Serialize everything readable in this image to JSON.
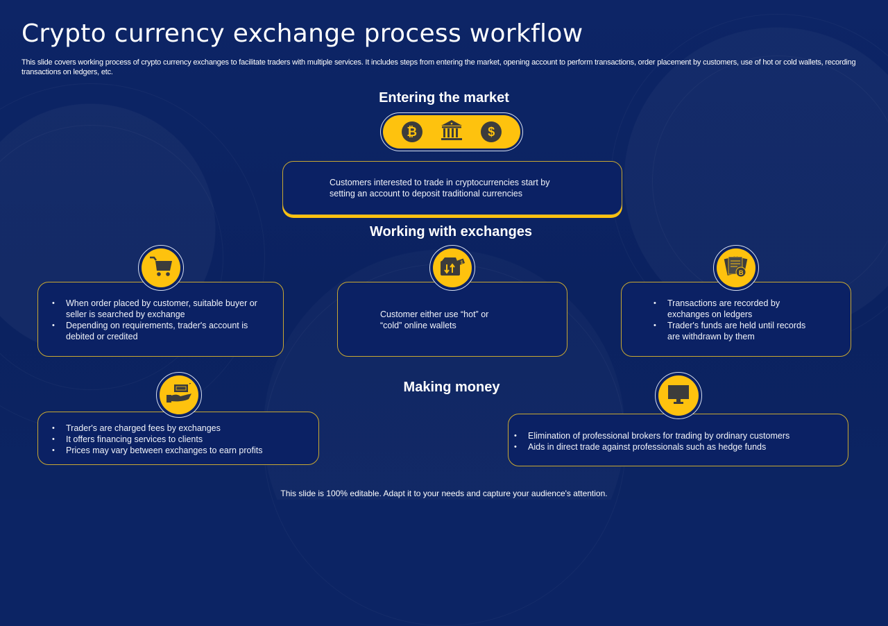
{
  "slide": {
    "title": "Crypto currency exchange process workflow",
    "subtitle": "This slide covers working process of crypto currency exchanges to facilitate traders with multiple services. It includes steps from entering the market, opening account to perform transactions, order placement by customers, use of hot or cold wallets, recording transactions on ledgers, etc.",
    "footer": "This slide is 100% editable. Adapt it to your needs and capture your audience's attention."
  },
  "colors": {
    "background": "#0c2464",
    "accent": "#fec20e",
    "box_border": "#c9a832",
    "icon_dark": "#3c3c3c"
  },
  "sections": {
    "entering": {
      "heading": "Entering the market",
      "icons": [
        "bitcoin-icon",
        "bank-icon",
        "dollar-icon"
      ],
      "bitcoin_glyph": "₿",
      "dollar_glyph": "$",
      "text": "Customers interested to trade in cryptocurrencies start by setting an account to deposit traditional currencies"
    },
    "working": {
      "heading": "Working with exchanges",
      "cards": [
        {
          "icon": "shopping-cart-icon",
          "bullets": [
            "When order placed by customer, suitable buyer or seller is searched by exchange",
            "Depending on requirements, trader's account is debited or credited"
          ]
        },
        {
          "icon": "wallet-transfer-icon",
          "text": "Customer either use “hot” or “cold” online wallets"
        },
        {
          "icon": "ledger-bitcoin-icon",
          "bullets": [
            "Transactions are recorded by exchanges on ledgers",
            "Trader's funds are held until records are withdrawn by them"
          ]
        }
      ]
    },
    "money": {
      "heading": "Making money",
      "cards": [
        {
          "icon": "hand-cash-icon",
          "bullets": [
            "Trader's are charged fees by exchanges",
            "It offers financing services to clients",
            "Prices may vary between exchanges to earn profits"
          ]
        },
        {
          "icon": "monitor-icon",
          "bullets": [
            "Elimination of professional brokers for trading by ordinary customers",
            "Aids in direct trade against professionals such as hedge funds"
          ]
        }
      ]
    }
  }
}
